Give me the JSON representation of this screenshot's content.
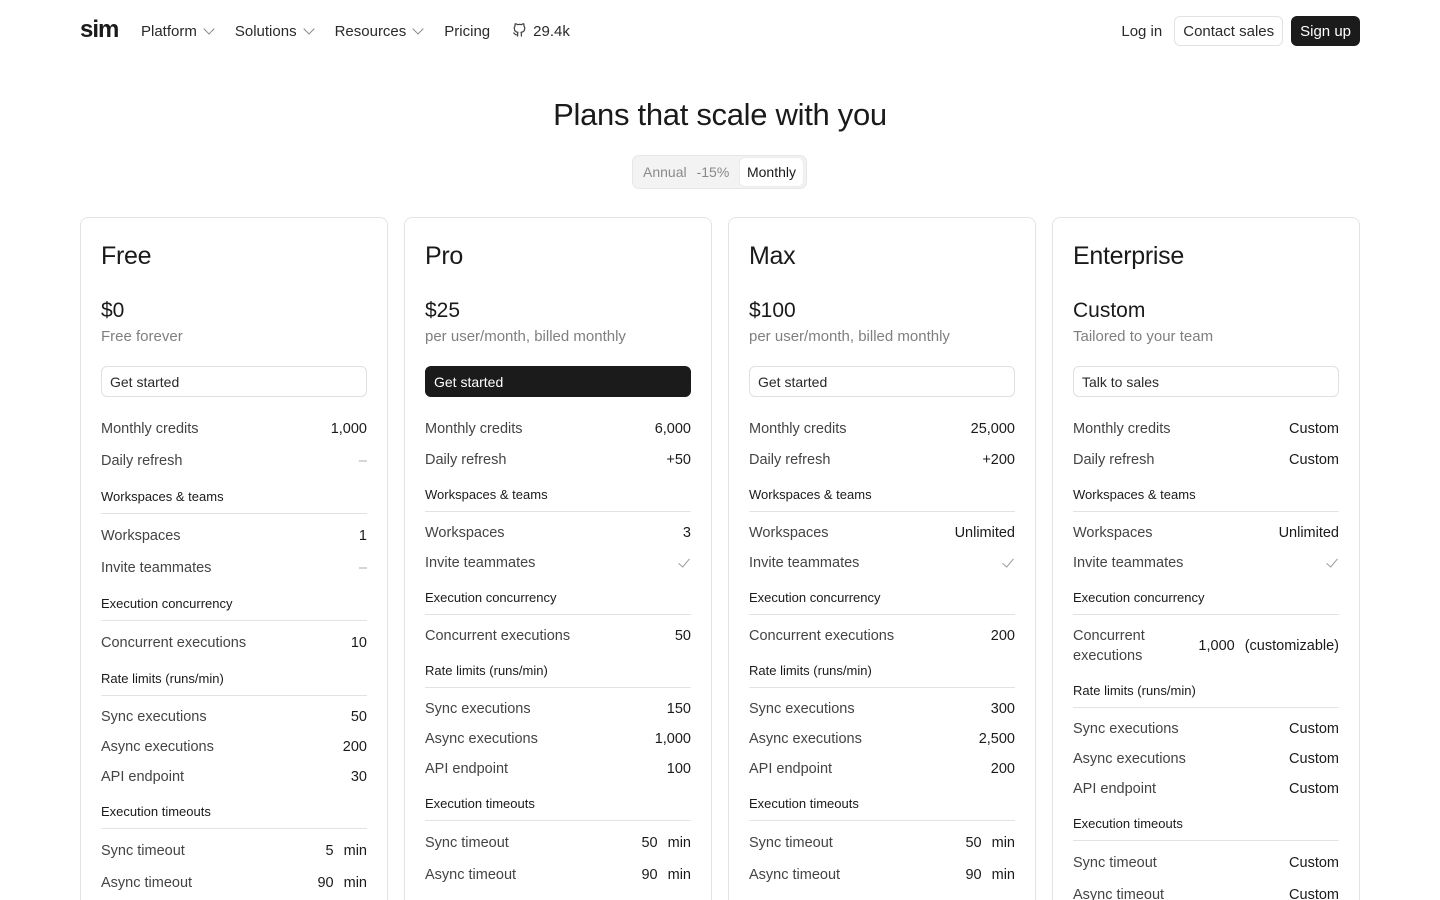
{
  "nav": {
    "logo": "sim",
    "links": [
      {
        "label": "Platform",
        "dropdown": true
      },
      {
        "label": "Solutions",
        "dropdown": true
      },
      {
        "label": "Resources",
        "dropdown": true
      },
      {
        "label": "Pricing",
        "dropdown": false
      }
    ],
    "github_stars": "29.4k",
    "login": "Log in",
    "contact": "Contact sales",
    "signup": "Sign up"
  },
  "hero": {
    "title": "Plans that scale with you",
    "toggle_annual": "Annual",
    "toggle_discount": "-15%",
    "toggle_monthly": "Monthly",
    "selected": "Monthly"
  },
  "sections": {
    "workspaces": "Workspaces & teams",
    "concurrency": "Execution concurrency",
    "rate_limits": "Rate limits (runs/min)",
    "timeouts": "Execution timeouts"
  },
  "labels": {
    "monthly_credits": "Monthly credits",
    "daily_refresh": "Daily refresh",
    "workspaces": "Workspaces",
    "invite": "Invite teammates",
    "concurrent": "Concurrent executions",
    "sync": "Sync executions",
    "async": "Async executions",
    "api": "API endpoint",
    "sync_timeout": "Sync timeout",
    "async_timeout": "Async timeout"
  },
  "plans": [
    {
      "name": "Free",
      "price": "$0",
      "price_sub": "Free forever",
      "cta": "Get started",
      "monthly_credits": "1,000",
      "daily_refresh": "–",
      "workspaces": "1",
      "invite": "–",
      "concurrent": "10",
      "sync": "50",
      "async": "200",
      "api": "30",
      "sync_timeout": "5",
      "async_timeout": "90",
      "unit": "min"
    },
    {
      "name": "Pro",
      "price": "$25",
      "price_sub": "per user/month, billed monthly",
      "cta": "Get started",
      "monthly_credits": "6,000",
      "daily_refresh": "+50",
      "workspaces": "3",
      "invite": "check",
      "concurrent": "50",
      "sync": "150",
      "async": "1,000",
      "api": "100",
      "sync_timeout": "50",
      "async_timeout": "90",
      "unit": "min"
    },
    {
      "name": "Max",
      "price": "$100",
      "price_sub": "per user/month, billed monthly",
      "cta": "Get started",
      "monthly_credits": "25,000",
      "daily_refresh": "+200",
      "workspaces": "Unlimited",
      "invite": "check",
      "concurrent": "200",
      "sync": "300",
      "async": "2,500",
      "api": "200",
      "sync_timeout": "50",
      "async_timeout": "90",
      "unit": "min"
    },
    {
      "name": "Enterprise",
      "price": "Custom",
      "price_sub": "Tailored to your team",
      "cta": "Talk to sales",
      "monthly_credits": "Custom",
      "daily_refresh": "Custom",
      "workspaces": "Unlimited",
      "invite": "check",
      "concurrent": "1,000",
      "concurrent_note": "(customizable)",
      "sync": "Custom",
      "async": "Custom",
      "api": "Custom",
      "sync_timeout": "Custom",
      "async_timeout": "Custom"
    }
  ]
}
